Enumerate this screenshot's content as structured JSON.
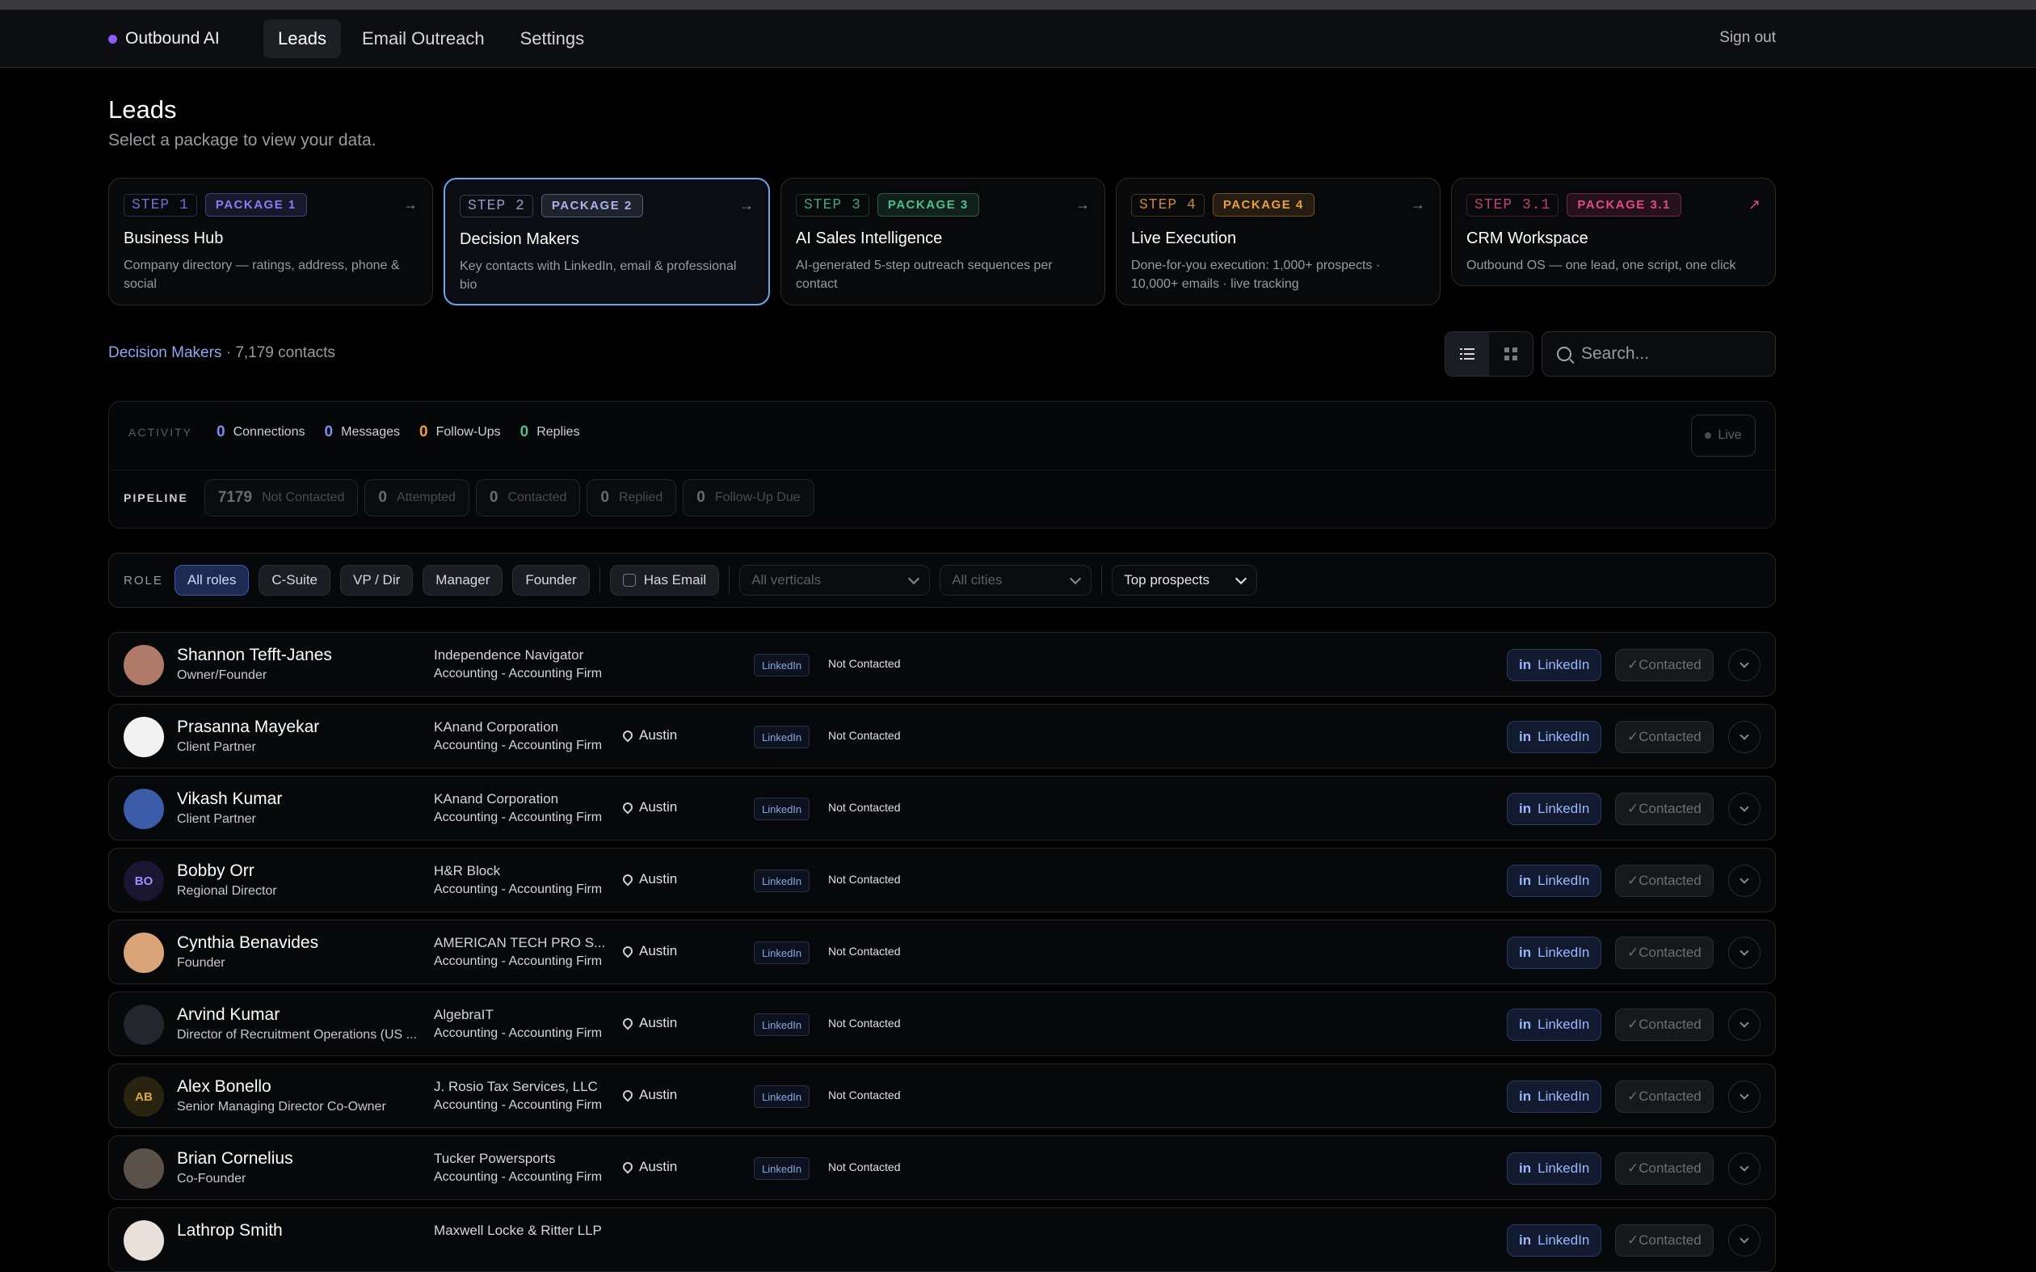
{
  "nav": {
    "brand": "Outbound AI",
    "links": [
      "Leads",
      "Email Outreach",
      "Settings"
    ],
    "sign_out": "Sign out"
  },
  "page": {
    "title": "Leads",
    "subtitle": "Select a package to view your data."
  },
  "packages": [
    {
      "step": "STEP 1",
      "package": "PACKAGE 1",
      "title": "Business Hub",
      "desc": "Company directory — ratings, address, phone & social",
      "arrow": "→",
      "color": "#8b7cf6"
    },
    {
      "step": "STEP 2",
      "package": "PACKAGE 2",
      "title": "Decision Makers",
      "desc": "Key contacts with LinkedIn, email & professional bio",
      "arrow": "→",
      "color": "#a8b4e8"
    },
    {
      "step": "STEP 3",
      "package": "PACKAGE 3",
      "title": "AI Sales Intelligence",
      "desc": "AI-generated 5-step outreach sequences per contact",
      "arrow": "→",
      "color": "#4fbf8a"
    },
    {
      "step": "STEP 4",
      "package": "PACKAGE 4",
      "title": "Live Execution",
      "desc": "Done-for-you execution: 1,000+ prospects · 10,000+ emails · live tracking",
      "arrow": "→",
      "color": "#e8a040"
    },
    {
      "step": "STEP 3.1",
      "package": "PACKAGE 3.1",
      "title": "CRM Workspace",
      "desc": "Outbound OS — one lead, one script, one click",
      "arrow": "↗",
      "color": "#e04c82"
    }
  ],
  "section": {
    "name": "Decision Makers",
    "count": "· 7,179 contacts",
    "search_placeholder": "Search..."
  },
  "activity": {
    "label": "ACTIVITY",
    "items": [
      {
        "n": "0",
        "t": "Connections",
        "color": "#7d8cf0"
      },
      {
        "n": "0",
        "t": "Messages",
        "color": "#7d8cf0"
      },
      {
        "n": "0",
        "t": "Follow-Ups",
        "color": "#e8a040"
      },
      {
        "n": "0",
        "t": "Replies",
        "color": "#4fbf8a"
      }
    ],
    "live": "Live"
  },
  "pipeline": {
    "label": "PIPELINE",
    "items": [
      {
        "n": "7179",
        "t": "Not Contacted"
      },
      {
        "n": "0",
        "t": "Attempted"
      },
      {
        "n": "0",
        "t": "Contacted"
      },
      {
        "n": "0",
        "t": "Replied"
      },
      {
        "n": "0",
        "t": "Follow-Up Due"
      }
    ]
  },
  "filters": {
    "role_label": "ROLE",
    "roles": [
      "All roles",
      "C-Suite",
      "VP / Dir",
      "Manager",
      "Founder"
    ],
    "has_email": "Has Email",
    "verticals": "All verticals",
    "cities": "All cities",
    "sort": "Top prospects"
  },
  "row_actions": {
    "linkedin": "LinkedIn",
    "contacted": "✓Contacted",
    "tag": "LinkedIn"
  },
  "leads": [
    {
      "name": "Shannon Tefft-Janes",
      "role": "Owner/Founder",
      "company": "Independence Navigator",
      "industry": "Accounting - Accounting Firm",
      "city": "",
      "status": "Not Contacted",
      "initials": "",
      "avatar_color": "#b07a6a"
    },
    {
      "name": "Prasanna Mayekar",
      "role": "Client Partner",
      "company": "KAnand Corporation",
      "industry": "Accounting - Accounting Firm",
      "city": "Austin",
      "status": "Not Contacted",
      "initials": "",
      "avatar_color": "#f2f2f2"
    },
    {
      "name": "Vikash Kumar",
      "role": "Client Partner",
      "company": "KAnand Corporation",
      "industry": "Accounting - Accounting Firm",
      "city": "Austin",
      "status": "Not Contacted",
      "initials": "",
      "avatar_color": "#3a5ca8"
    },
    {
      "name": "Bobby Orr",
      "role": "Regional Director",
      "company": "H&R Block",
      "industry": "Accounting - Accounting Firm",
      "city": "Austin",
      "status": "Not Contacted",
      "initials": "BO",
      "avatar_color": "#1a1530"
    },
    {
      "name": "Cynthia Benavides",
      "role": "Founder",
      "company": "AMERICAN TECH PRO S...",
      "industry": "Accounting - Accounting Firm",
      "city": "Austin",
      "status": "Not Contacted",
      "initials": "",
      "avatar_color": "#d8a478"
    },
    {
      "name": "Arvind Kumar",
      "role": "Director of Recruitment Operations (US ...",
      "company": "AlgebraIT",
      "industry": "Accounting - Accounting Firm",
      "city": "Austin",
      "status": "Not Contacted",
      "initials": "",
      "avatar_color": "#23262c"
    },
    {
      "name": "Alex Bonello",
      "role": "Senior Managing Director Co-Owner",
      "company": "J. Rosio Tax Services, LLC",
      "industry": "Accounting - Accounting Firm",
      "city": "Austin",
      "status": "Not Contacted",
      "initials": "AB",
      "avatar_color": "#2a2310"
    },
    {
      "name": "Brian Cornelius",
      "role": "Co-Founder",
      "company": "Tucker Powersports",
      "industry": "Accounting - Accounting Firm",
      "city": "Austin",
      "status": "Not Contacted",
      "initials": "",
      "avatar_color": "#5a5248"
    },
    {
      "name": "Lathrop Smith",
      "role": "",
      "company": "Maxwell Locke & Ritter LLP",
      "industry": "",
      "city": "",
      "status": "",
      "initials": "",
      "avatar_color": "#e8e0d8"
    }
  ]
}
